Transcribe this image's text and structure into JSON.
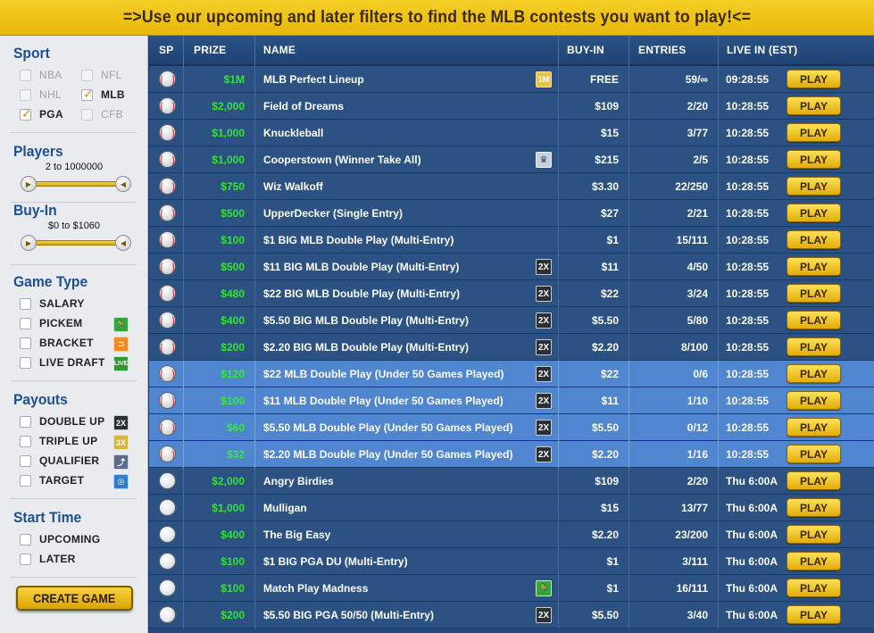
{
  "banner": "=>Use our upcoming and later filters to find the MLB contests you want to play!<=",
  "sidebar": {
    "sport_title": "Sport",
    "sports": [
      {
        "label": "NBA",
        "checked": false,
        "disabled": true
      },
      {
        "label": "NFL",
        "checked": false,
        "disabled": true
      },
      {
        "label": "NHL",
        "checked": false,
        "disabled": true
      },
      {
        "label": "MLB",
        "checked": true,
        "disabled": false
      },
      {
        "label": "PGA",
        "checked": true,
        "disabled": false
      },
      {
        "label": "CFB",
        "checked": false,
        "disabled": true
      }
    ],
    "players_title": "Players",
    "players_range": "2 to 1000000",
    "buyin_title": "Buy-In",
    "buyin_range": "$0 to $1060",
    "gametype_title": "Game Type",
    "gametypes": [
      {
        "label": "SALARY",
        "icon": ""
      },
      {
        "label": "PICKEM",
        "icon": "runner-icon"
      },
      {
        "label": "BRACKET",
        "icon": "bracket-icon"
      },
      {
        "label": "LIVE DRAFT",
        "icon": "live-icon",
        "icon_text": "LIVE"
      }
    ],
    "payouts_title": "Payouts",
    "payouts": [
      {
        "label": "DOUBLE UP",
        "icon": "double-up-icon",
        "icon_text": "2X"
      },
      {
        "label": "TRIPLE UP",
        "icon": "triple-up-icon",
        "icon_text": "3X"
      },
      {
        "label": "QUALIFIER",
        "icon": "qualifier-icon"
      },
      {
        "label": "TARGET",
        "icon": "target-icon"
      }
    ],
    "starttime_title": "Start Time",
    "starttimes": [
      {
        "label": "UPCOMING"
      },
      {
        "label": "LATER"
      }
    ],
    "create_button": "CREATE GAME"
  },
  "table": {
    "headers": {
      "sp": "SP",
      "prize": "PRIZE",
      "name": "NAME",
      "buyin": "BUY-IN",
      "entries": "ENTRIES",
      "live": "LIVE IN (EST)"
    },
    "play_label": "PLAY",
    "rows": [
      {
        "sport": "baseball",
        "prize": "$1M",
        "name": "MLB Perfect Lineup",
        "badge": "1M",
        "badge_type": "m1",
        "buyin": "FREE",
        "entries": "59/∞",
        "live": "09:28:55",
        "highlight": false
      },
      {
        "sport": "baseball",
        "prize": "$2,000",
        "name": "Field of Dreams",
        "badge": "",
        "badge_type": "",
        "buyin": "$109",
        "entries": "2/20",
        "live": "10:28:55",
        "highlight": false
      },
      {
        "sport": "baseball",
        "prize": "$1,000",
        "name": "Knuckleball",
        "badge": "",
        "badge_type": "",
        "buyin": "$15",
        "entries": "3/77",
        "live": "10:28:55",
        "highlight": false
      },
      {
        "sport": "baseball",
        "prize": "$1,000",
        "name": "Cooperstown (Winner Take All)",
        "badge": "",
        "badge_type": "wta",
        "buyin": "$215",
        "entries": "2/5",
        "live": "10:28:55",
        "highlight": false
      },
      {
        "sport": "baseball",
        "prize": "$750",
        "name": "Wiz Walkoff",
        "badge": "",
        "badge_type": "",
        "buyin": "$3.30",
        "entries": "22/250",
        "live": "10:28:55",
        "highlight": false
      },
      {
        "sport": "baseball",
        "prize": "$500",
        "name": "UpperDecker (Single Entry)",
        "badge": "",
        "badge_type": "",
        "buyin": "$27",
        "entries": "2/21",
        "live": "10:28:55",
        "highlight": false
      },
      {
        "sport": "baseball",
        "prize": "$100",
        "name": "$1 BIG MLB Double Play (Multi-Entry)",
        "badge": "",
        "badge_type": "",
        "buyin": "$1",
        "entries": "15/111",
        "live": "10:28:55",
        "highlight": false
      },
      {
        "sport": "baseball",
        "prize": "$500",
        "name": "$11 BIG MLB Double Play (Multi-Entry)",
        "badge": "2X",
        "badge_type": "x2",
        "buyin": "$11",
        "entries": "4/50",
        "live": "10:28:55",
        "highlight": false
      },
      {
        "sport": "baseball",
        "prize": "$480",
        "name": "$22 BIG MLB Double Play (Multi-Entry)",
        "badge": "2X",
        "badge_type": "x2",
        "buyin": "$22",
        "entries": "3/24",
        "live": "10:28:55",
        "highlight": false
      },
      {
        "sport": "baseball",
        "prize": "$400",
        "name": "$5.50 BIG MLB Double Play (Multi-Entry)",
        "badge": "2X",
        "badge_type": "x2",
        "buyin": "$5.50",
        "entries": "5/80",
        "live": "10:28:55",
        "highlight": false
      },
      {
        "sport": "baseball",
        "prize": "$200",
        "name": "$2.20 BIG MLB Double Play (Multi-Entry)",
        "badge": "2X",
        "badge_type": "x2",
        "buyin": "$2.20",
        "entries": "8/100",
        "live": "10:28:55",
        "highlight": false
      },
      {
        "sport": "baseball",
        "prize": "$120",
        "name": "$22 MLB Double Play (Under 50 Games Played)",
        "badge": "2X",
        "badge_type": "x2",
        "buyin": "$22",
        "entries": "0/6",
        "live": "10:28:55",
        "highlight": true
      },
      {
        "sport": "baseball",
        "prize": "$100",
        "name": "$11 MLB Double Play (Under 50 Games Played)",
        "badge": "2X",
        "badge_type": "x2",
        "buyin": "$11",
        "entries": "1/10",
        "live": "10:28:55",
        "highlight": true
      },
      {
        "sport": "baseball",
        "prize": "$60",
        "name": "$5.50 MLB Double Play (Under 50 Games Played)",
        "badge": "2X",
        "badge_type": "x2",
        "buyin": "$5.50",
        "entries": "0/12",
        "live": "10:28:55",
        "highlight": true
      },
      {
        "sport": "baseball",
        "prize": "$32",
        "name": "$2.20 MLB Double Play (Under 50 Games Played)",
        "badge": "2X",
        "badge_type": "x2",
        "buyin": "$2.20",
        "entries": "1/16",
        "live": "10:28:55",
        "highlight": true
      },
      {
        "sport": "golf",
        "prize": "$2,000",
        "name": "Angry Birdies",
        "badge": "",
        "badge_type": "",
        "buyin": "$109",
        "entries": "2/20",
        "live": "Thu 6:00A",
        "highlight": false
      },
      {
        "sport": "golf",
        "prize": "$1,000",
        "name": "Mulligan",
        "badge": "",
        "badge_type": "",
        "buyin": "$15",
        "entries": "13/77",
        "live": "Thu 6:00A",
        "highlight": false
      },
      {
        "sport": "golf",
        "prize": "$400",
        "name": "The Big Easy",
        "badge": "",
        "badge_type": "",
        "buyin": "$2.20",
        "entries": "23/200",
        "live": "Thu 6:00A",
        "highlight": false
      },
      {
        "sport": "golf",
        "prize": "$100",
        "name": "$1 BIG PGA DU (Multi-Entry)",
        "badge": "",
        "badge_type": "",
        "buyin": "$1",
        "entries": "3/111",
        "live": "Thu 6:00A",
        "highlight": false
      },
      {
        "sport": "golf",
        "prize": "$100",
        "name": "Match Play Madness",
        "badge": "",
        "badge_type": "pk",
        "buyin": "$1",
        "entries": "16/111",
        "live": "Thu 6:00A",
        "highlight": false
      },
      {
        "sport": "golf",
        "prize": "$200",
        "name": "$5.50 BIG PGA 50/50 (Multi-Entry)",
        "badge": "2X",
        "badge_type": "x2",
        "buyin": "$5.50",
        "entries": "3/40",
        "live": "Thu 6:00A",
        "highlight": false
      }
    ]
  }
}
